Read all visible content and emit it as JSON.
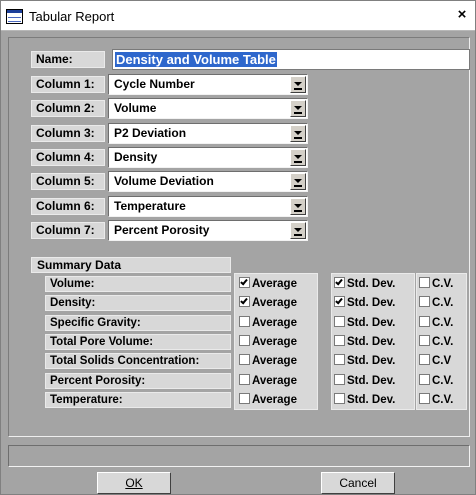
{
  "window": {
    "title": "Tabular Report",
    "close_label": "×"
  },
  "name_field": {
    "label": "Name:",
    "value": "Density and Volume Table"
  },
  "columns": [
    {
      "label": "Column 1:",
      "value": "Cycle Number"
    },
    {
      "label": "Column 2:",
      "value": "Volume"
    },
    {
      "label": "Column 3:",
      "value": "P2 Deviation"
    },
    {
      "label": "Column 4:",
      "value": "Density"
    },
    {
      "label": "Column 5:",
      "value": "Volume Deviation"
    },
    {
      "label": "Column 6:",
      "value": "Temperature"
    },
    {
      "label": "Column 7:",
      "value": "Percent Porosity"
    }
  ],
  "summary": {
    "title": "Summary Data",
    "rows": [
      {
        "label": "Volume:",
        "average": true,
        "std_dev": true,
        "cv": false,
        "avg_label": "Average",
        "std_label": "Std. Dev.",
        "cv_label": "C.V."
      },
      {
        "label": "Density:",
        "average": true,
        "std_dev": true,
        "cv": false,
        "avg_label": "Average",
        "std_label": "Std. Dev.",
        "cv_label": "C.V."
      },
      {
        "label": "Specific Gravity:",
        "average": false,
        "std_dev": false,
        "cv": false,
        "avg_label": "Average",
        "std_label": "Std. Dev.",
        "cv_label": "C.V."
      },
      {
        "label": "Total Pore Volume:",
        "average": false,
        "std_dev": false,
        "cv": false,
        "avg_label": "Average",
        "std_label": "Std. Dev.",
        "cv_label": "C.V."
      },
      {
        "label": "Total Solids Concentration:",
        "average": false,
        "std_dev": false,
        "cv": false,
        "avg_label": "Average",
        "std_label": "Std. Dev.",
        "cv_label": "C.V"
      },
      {
        "label": "Percent Porosity:",
        "average": false,
        "std_dev": false,
        "cv": false,
        "avg_label": "Average",
        "std_label": "Std. Dev.",
        "cv_label": "C.V."
      },
      {
        "label": "Temperature:",
        "average": false,
        "std_dev": false,
        "cv": false,
        "avg_label": "Average",
        "std_label": "Std. Dev.",
        "cv_label": "C.V."
      }
    ]
  },
  "buttons": {
    "ok": "OK",
    "cancel": "Cancel"
  },
  "colors": {
    "dialog_bg": "#a4a4a4",
    "label_bg": "#d8d8d8",
    "selection": "#2e67cc"
  }
}
